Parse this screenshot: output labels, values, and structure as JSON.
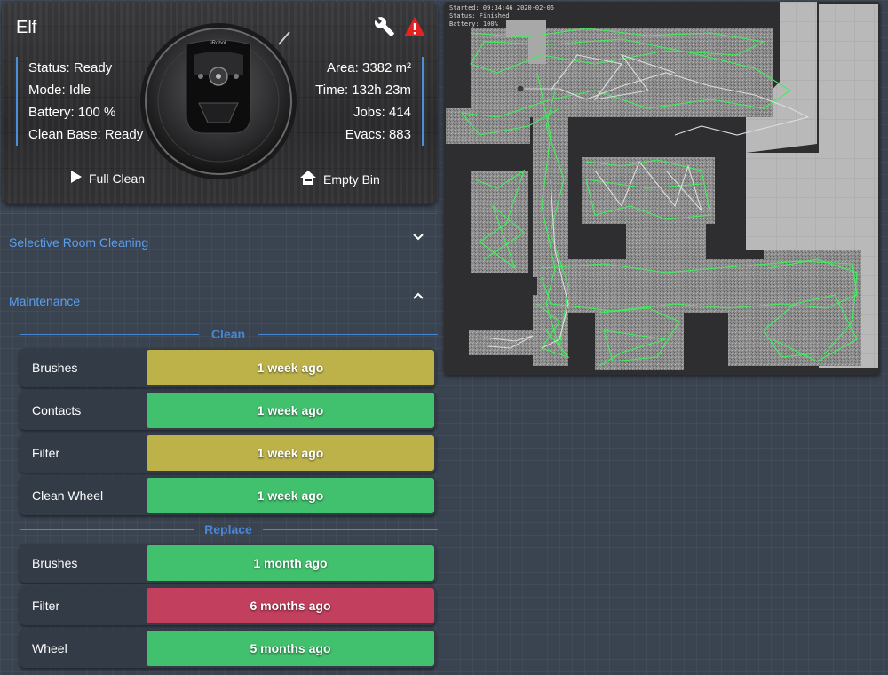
{
  "vacuum": {
    "name": "Elf",
    "status": "Status: Ready",
    "mode": "Mode: Idle",
    "battery": "Battery: 100 %",
    "clean_base": "Clean Base: Ready",
    "area": "Area: 3382 m²",
    "time": "Time: 132h 23m",
    "jobs": "Jobs: 414",
    "evacs": "Evacs: 883",
    "full_clean_label": "Full Clean",
    "empty_bin_label": "Empty Bin",
    "robot_brand": "iRobot",
    "warning_color": "#e32222",
    "accent_color": "#4a90d9"
  },
  "sections": {
    "selective": "Selective Room Cleaning",
    "maintenance": "Maintenance"
  },
  "maintenance": {
    "clean_header": "Clean",
    "replace_header": "Replace",
    "clean": [
      {
        "label": "Brushes",
        "value": "1 week ago",
        "color": "#bdb24a"
      },
      {
        "label": "Contacts",
        "value": "1 week ago",
        "color": "#41c06d"
      },
      {
        "label": "Filter",
        "value": "1 week ago",
        "color": "#bdb24a"
      },
      {
        "label": "Clean Wheel",
        "value": "1 week ago",
        "color": "#41c06d"
      }
    ],
    "replace": [
      {
        "label": "Brushes",
        "value": "1 month ago",
        "color": "#41c06d"
      },
      {
        "label": "Filter",
        "value": "6 months ago",
        "color": "#c23f5e"
      },
      {
        "label": "Wheel",
        "value": "5 months ago",
        "color": "#41c06d"
      }
    ]
  },
  "map": {
    "started": "Started: 09:34:46 2020-02-06",
    "status": "Status: Finished",
    "battery": "Battery: 100%"
  }
}
